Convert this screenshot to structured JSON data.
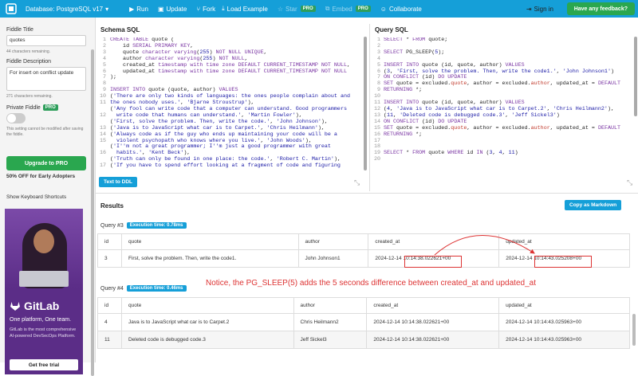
{
  "topbar": {
    "database": "Database: PostgreSQL v17",
    "run": "Run",
    "update": "Update",
    "fork": "Fork",
    "load_example": "Load Example",
    "star": "Star",
    "embed": "Embed",
    "pro": "PRO",
    "collaborate": "Collaborate",
    "signin": "Sign in",
    "feedback": "Have any feedback?"
  },
  "sidebar": {
    "fiddle_title_label": "Fiddle Title",
    "fiddle_title_value": "quotes",
    "title_remaining": "44 characters remaining.",
    "desc_label": "Fiddle Description",
    "desc_value": "For insert on conflict update",
    "desc_remaining": "271 characters remaining.",
    "private_label": "Private Fiddle",
    "private_badge": "PRO",
    "private_note": "This setting cannot be modified after saving the fiddle.",
    "upgrade": "Upgrade to PRO",
    "discount": "50% OFF for Early Adopters",
    "shortcuts": "Show Keyboard Shortcuts",
    "ad": {
      "brand": "GitLab",
      "headline": "One platform, One team.",
      "body": "GitLab is the most comprehensive AI-powered DevSecOps Platform.",
      "cta": "Get free trial"
    }
  },
  "schema": {
    "title": "Schema SQL",
    "to_ddl": "Text to DDL"
  },
  "query": {
    "title": "Query SQL"
  },
  "results": {
    "title": "Results",
    "copy": "Copy as Markdown",
    "q3": {
      "label": "Query #3",
      "exec": "Execution time: 0.78ms",
      "headers": [
        "id",
        "quote",
        "author",
        "created_at",
        "updated_at"
      ],
      "rows": [
        [
          "3",
          "First, solve the problem. Then, write the code1.",
          "John Johnson1",
          "2024-12-14 10:14:38.022621+00",
          "2024-12-14 10:14:43.025208+00"
        ]
      ]
    },
    "q4": {
      "label": "Query #4",
      "exec": "Execution time: 0.46ms",
      "headers": [
        "id",
        "quote",
        "author",
        "created_at",
        "updated_at"
      ],
      "rows": [
        [
          "4",
          "Java is to JavaScript what car is to Carpet.2",
          "Chris Heilmann2",
          "2024-12-14 10:14:38.022621+00",
          "2024-12-14 10:14:43.025963+00"
        ],
        [
          "11",
          "Deleted code is debugged code.3",
          "Jeff Sickel3",
          "2024-12-14 10:14:38.022621+00",
          "2024-12-14 10:14:43.025963+00"
        ]
      ]
    },
    "notice": "Notice, the PG_SLEEP(5) adds the 5 seconds difference between created_at and updated_at"
  },
  "colors": {
    "topbar": "#159fd8",
    "green": "#2aa74f",
    "ad": "#5b2d87",
    "annotation": "#dd3333"
  }
}
